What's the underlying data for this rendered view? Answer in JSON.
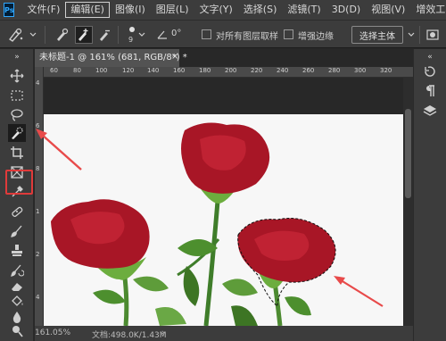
{
  "app": {
    "logo_text": "Ps"
  },
  "menu": {
    "items": [
      {
        "label": "文件(F)"
      },
      {
        "label": "编辑(E)"
      },
      {
        "label": "图像(I)"
      },
      {
        "label": "图层(L)"
      },
      {
        "label": "文字(Y)"
      },
      {
        "label": "选择(S)"
      },
      {
        "label": "滤镜(T)"
      },
      {
        "label": "3D(D)"
      },
      {
        "label": "视图(V)"
      },
      {
        "label": "增效工具"
      }
    ],
    "active_label": "编辑(E)"
  },
  "options": {
    "brush_size": "9",
    "angle": "0°",
    "sample_all_layers_label": "对所有图层取样",
    "sample_all_layers_checked": false,
    "enhance_edge_label": "增强边缘",
    "enhance_edge_checked": false,
    "select_subject_label": "选择主体"
  },
  "toolbar": {
    "active_tool_icon": "quick-selection-icon",
    "highlight_color": "#e03a3a"
  },
  "document": {
    "tab_title": "未标题-1 @ 161% (681, RGB/8*) *",
    "tab_close": "×",
    "ruler_top_labels": [
      "60",
      "80",
      "100",
      "120",
      "140",
      "160",
      "180",
      "200",
      "220",
      "240",
      "260",
      "280",
      "300",
      "320"
    ],
    "ruler_left_labels": [
      "4",
      "6",
      "8",
      "1",
      "2",
      "4"
    ]
  },
  "status": {
    "zoom": "161.05%",
    "doc_size": "文档:498.0K/1.43M"
  },
  "annotation": {
    "arrow_color": "#e84a4a"
  }
}
